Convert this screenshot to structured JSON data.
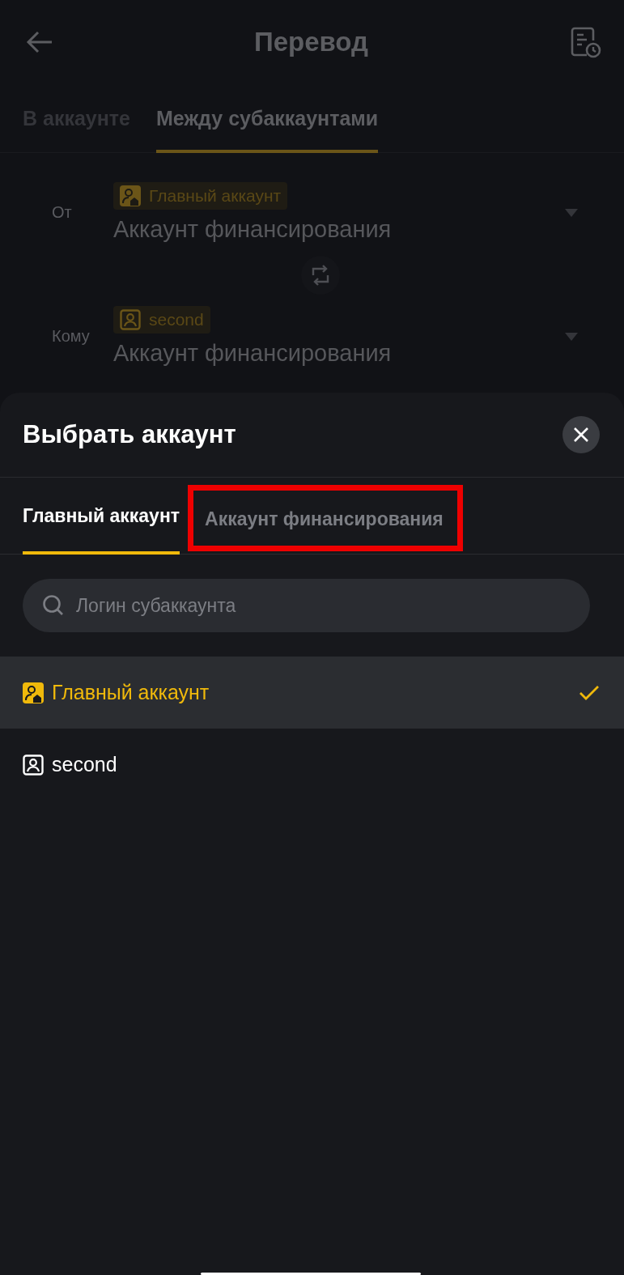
{
  "header": {
    "title": "Перевод"
  },
  "tabs": [
    {
      "label": "В аккаунте",
      "selected": false
    },
    {
      "label": "Между субаккаунтами",
      "selected": true
    }
  ],
  "transfer": [
    {
      "label": "От",
      "account_tag": "Главный аккаунт",
      "kind": "main",
      "wallet": "Аккаунт финансирования"
    },
    {
      "label": "Кому",
      "account_tag": "second",
      "kind": "sub",
      "wallet": "Аккаунт финансирования"
    }
  ],
  "sheet": {
    "title": "Выбрать аккаунт",
    "tabs": [
      {
        "label": "Главный аккаунт",
        "selected": true,
        "highlighted": false
      },
      {
        "label": "Аккаунт финансирования",
        "selected": false,
        "highlighted": true
      }
    ],
    "search": {
      "placeholder": "Логин субаккаунта"
    },
    "accounts": [
      {
        "name": "Главный аккаунт",
        "kind": "main",
        "selected": true
      },
      {
        "name": "second",
        "kind": "sub",
        "selected": false
      }
    ]
  }
}
